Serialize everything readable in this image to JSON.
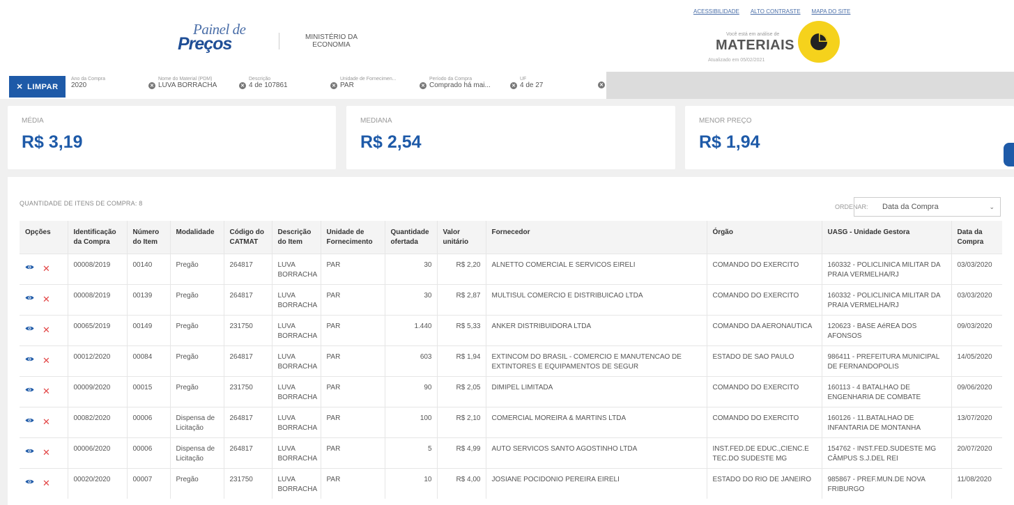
{
  "header": {
    "logo_top": "Painel de",
    "logo_main": "Preços",
    "ministry_line1": "MINISTÉRIO DA",
    "ministry_line2": "ECONOMIA",
    "links": [
      "ACESSIBILIDADE",
      "ALTO CONTRASTE",
      "MAPA DO SITE"
    ],
    "analysis_label": "Você está em análise de",
    "analysis_value": "MATERIAIS",
    "updated": "Atualizado em 05/02/2021",
    "colors": {
      "brand_blue": "#1e5aa8",
      "badge_yellow": "#f5d21c"
    }
  },
  "filters": {
    "clear_label": "LIMPAR",
    "items": [
      {
        "label": "Ano da Compra",
        "value": "2020"
      },
      {
        "label": "Nome do Material (PDM)",
        "value": "LUVA BORRACHA"
      },
      {
        "label": "Descrição",
        "value": "4 de 107861"
      },
      {
        "label": "Unidade de Fornecimen...",
        "value": "PAR"
      },
      {
        "label": "Período da Compra",
        "value": "Comprado há mai..."
      },
      {
        "label": "UF",
        "value": "4 de 27"
      }
    ]
  },
  "stats": [
    {
      "label": "MÉDIA",
      "value": "R$ 3,19"
    },
    {
      "label": "MEDIANA",
      "value": "R$ 2,54"
    },
    {
      "label": "MENOR PREÇO",
      "value": "R$ 1,94"
    }
  ],
  "table": {
    "count_label": "QUANTIDADE DE ITENS DE COMPRA: 8",
    "order_label": "ORDENAR:",
    "order_value": "Data da Compra",
    "columns": [
      "Opções",
      "Identificação da Compra",
      "Número do Item",
      "Modalidade",
      "Código do CATMAT",
      "Descrição do Item",
      "Unidade de Fornecimento",
      "Quantidade ofertada",
      "Valor unitário",
      "Fornecedor",
      "Órgão",
      "UASG - Unidade Gestora",
      "Data da Compra"
    ],
    "rows": [
      [
        "00008/2019",
        "00140",
        "Pregão",
        "264817",
        "LUVA BORRACHA",
        "PAR",
        "30",
        "R$ 2,20",
        "ALNETTO COMERCIAL E SERVICOS EIRELI",
        "COMANDO DO EXERCITO",
        "160332 - POLICLINICA MILITAR DA PRAIA VERMELHA/RJ",
        "03/03/2020"
      ],
      [
        "00008/2019",
        "00139",
        "Pregão",
        "264817",
        "LUVA BORRACHA",
        "PAR",
        "30",
        "R$ 2,87",
        "MULTISUL COMERCIO E DISTRIBUICAO LTDA",
        "COMANDO DO EXERCITO",
        "160332 - POLICLINICA MILITAR DA PRAIA VERMELHA/RJ",
        "03/03/2020"
      ],
      [
        "00065/2019",
        "00149",
        "Pregão",
        "231750",
        "LUVA BORRACHA",
        "PAR",
        "1.440",
        "R$ 5,33",
        "ANKER DISTRIBUIDORA LTDA",
        "COMANDO DA AERONAUTICA",
        "120623 - BASE AéREA DOS AFONSOS",
        "09/03/2020"
      ],
      [
        "00012/2020",
        "00084",
        "Pregão",
        "264817",
        "LUVA BORRACHA",
        "PAR",
        "603",
        "R$ 1,94",
        "EXTINCOM DO BRASIL - COMERCIO E MANUTENCAO DE EXTINTORES E EQUIPAMENTOS DE SEGUR",
        "ESTADO DE SAO PAULO",
        "986411 - PREFEITURA MUNICIPAL DE FERNANDOPOLIS",
        "14/05/2020"
      ],
      [
        "00009/2020",
        "00015",
        "Pregão",
        "231750",
        "LUVA BORRACHA",
        "PAR",
        "90",
        "R$ 2,05",
        "DIMIPEL LIMITADA",
        "COMANDO DO EXERCITO",
        "160113 - 4 BATALHAO DE ENGENHARIA DE COMBATE",
        "09/06/2020"
      ],
      [
        "00082/2020",
        "00006",
        "Dispensa de Licitação",
        "264817",
        "LUVA BORRACHA",
        "PAR",
        "100",
        "R$ 2,10",
        "COMERCIAL MOREIRA & MARTINS LTDA",
        "COMANDO DO EXERCITO",
        "160126 - 11.BATALHAO DE INFANTARIA DE MONTANHA",
        "13/07/2020"
      ],
      [
        "00006/2020",
        "00006",
        "Dispensa de Licitação",
        "264817",
        "LUVA BORRACHA",
        "PAR",
        "5",
        "R$ 4,99",
        "AUTO SERVICOS SANTO AGOSTINHO LTDA",
        "INST.FED.DE EDUC.,CIENC.E TEC.DO SUDESTE MG",
        "154762 - INST.FED.SUDESTE MG CÂMPUS S.J.DEL REI",
        "20/07/2020"
      ],
      [
        "00020/2020",
        "00007",
        "Pregão",
        "231750",
        "LUVA BORRACHA",
        "PAR",
        "10",
        "R$ 4,00",
        "JOSIANE POCIDONIO PEREIRA EIRELI",
        "ESTADO DO RIO DE JANEIRO",
        "985867 - PREF.MUN.DE NOVA FRIBURGO",
        "11/08/2020"
      ]
    ]
  }
}
